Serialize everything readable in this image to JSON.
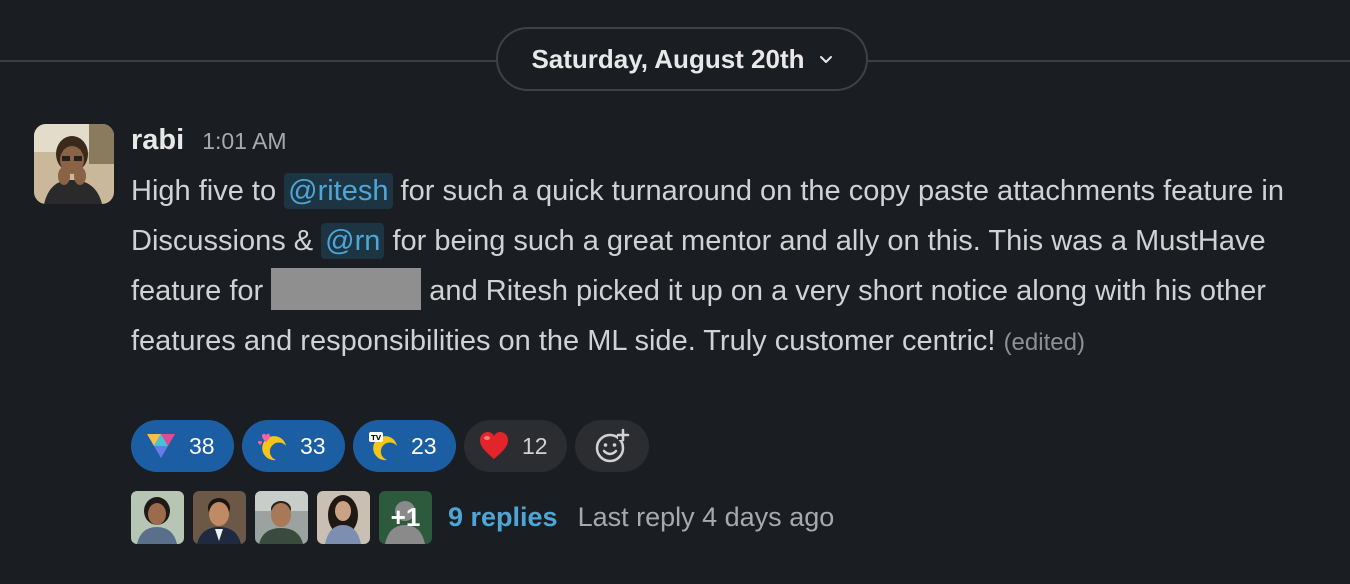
{
  "date_divider": {
    "label": "Saturday, August 20th"
  },
  "message": {
    "author": "rabi",
    "time": "1:01 AM",
    "text_parts": {
      "p1": "High five to ",
      "mention1": "@ritesh",
      "p2": " for such a quick turnaround on the copy paste attachments feature in Discussions & ",
      "mention2": "@rn",
      "p3": " for being such a great mentor and ally on this. This was a MustHave feature for ",
      "p4": " and Ritesh picked it up on a very short notice along with his other features and responsibilities on the ML side. Truly customer centric! ",
      "edited": "(edited)"
    }
  },
  "reactions": [
    {
      "emoji": "custom-triangle-emoji",
      "count": "38",
      "mine": true
    },
    {
      "emoji": "custom-heart-moon-emoji",
      "count": "33",
      "mine": true
    },
    {
      "emoji": "custom-tv-moon-emoji",
      "count": "23",
      "mine": true
    },
    {
      "emoji": "red-heart-emoji",
      "count": "12",
      "mine": false
    }
  ],
  "thread": {
    "extra_count": "+1",
    "replies": "9 replies",
    "last_reply": "Last reply 4 days ago"
  },
  "colors": {
    "background": "#1a1d21",
    "mention": "#4ea6d6",
    "reaction_mine": "#1c5ea3",
    "reaction_other": "#2b2d31"
  }
}
